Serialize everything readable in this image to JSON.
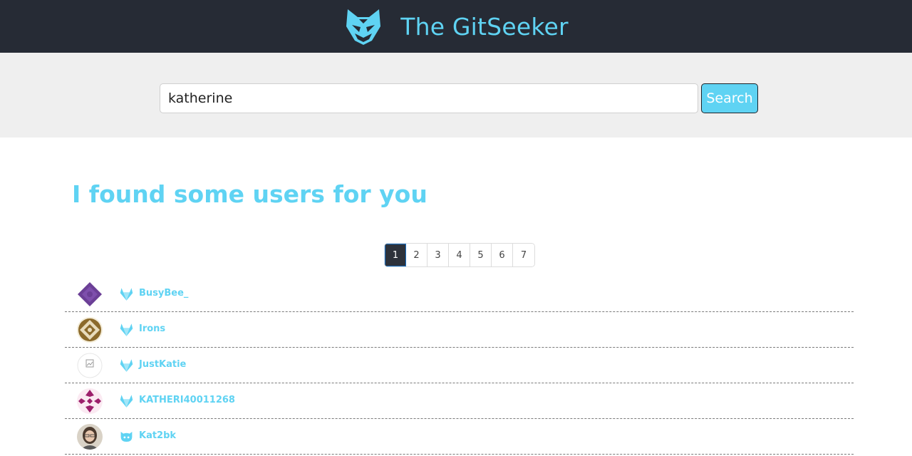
{
  "header": {
    "title": "The GitSeeker",
    "logo_icon": "fox-mask-icon",
    "accent": "#5fd3f3",
    "background": "#262b35"
  },
  "search": {
    "value": "katherine",
    "button_label": "Search"
  },
  "results": {
    "heading": "I found some users for you"
  },
  "pagination": {
    "pages": [
      "1",
      "2",
      "3",
      "4",
      "5",
      "6",
      "7"
    ],
    "active": "1"
  },
  "users": [
    {
      "name": "BusyBee_",
      "source": "gitlab-icon",
      "avatar": "purple-pattern-avatar"
    },
    {
      "name": "Irons",
      "source": "gitlab-icon",
      "avatar": "brown-pattern-avatar"
    },
    {
      "name": "JustKatie",
      "source": "gitlab-icon",
      "avatar": "broken-image-avatar"
    },
    {
      "name": "KATHERI40011268",
      "source": "gitlab-icon",
      "avatar": "magenta-pattern-avatar"
    },
    {
      "name": "Kat2bk",
      "source": "github-icon",
      "avatar": "photo-avatar"
    }
  ]
}
